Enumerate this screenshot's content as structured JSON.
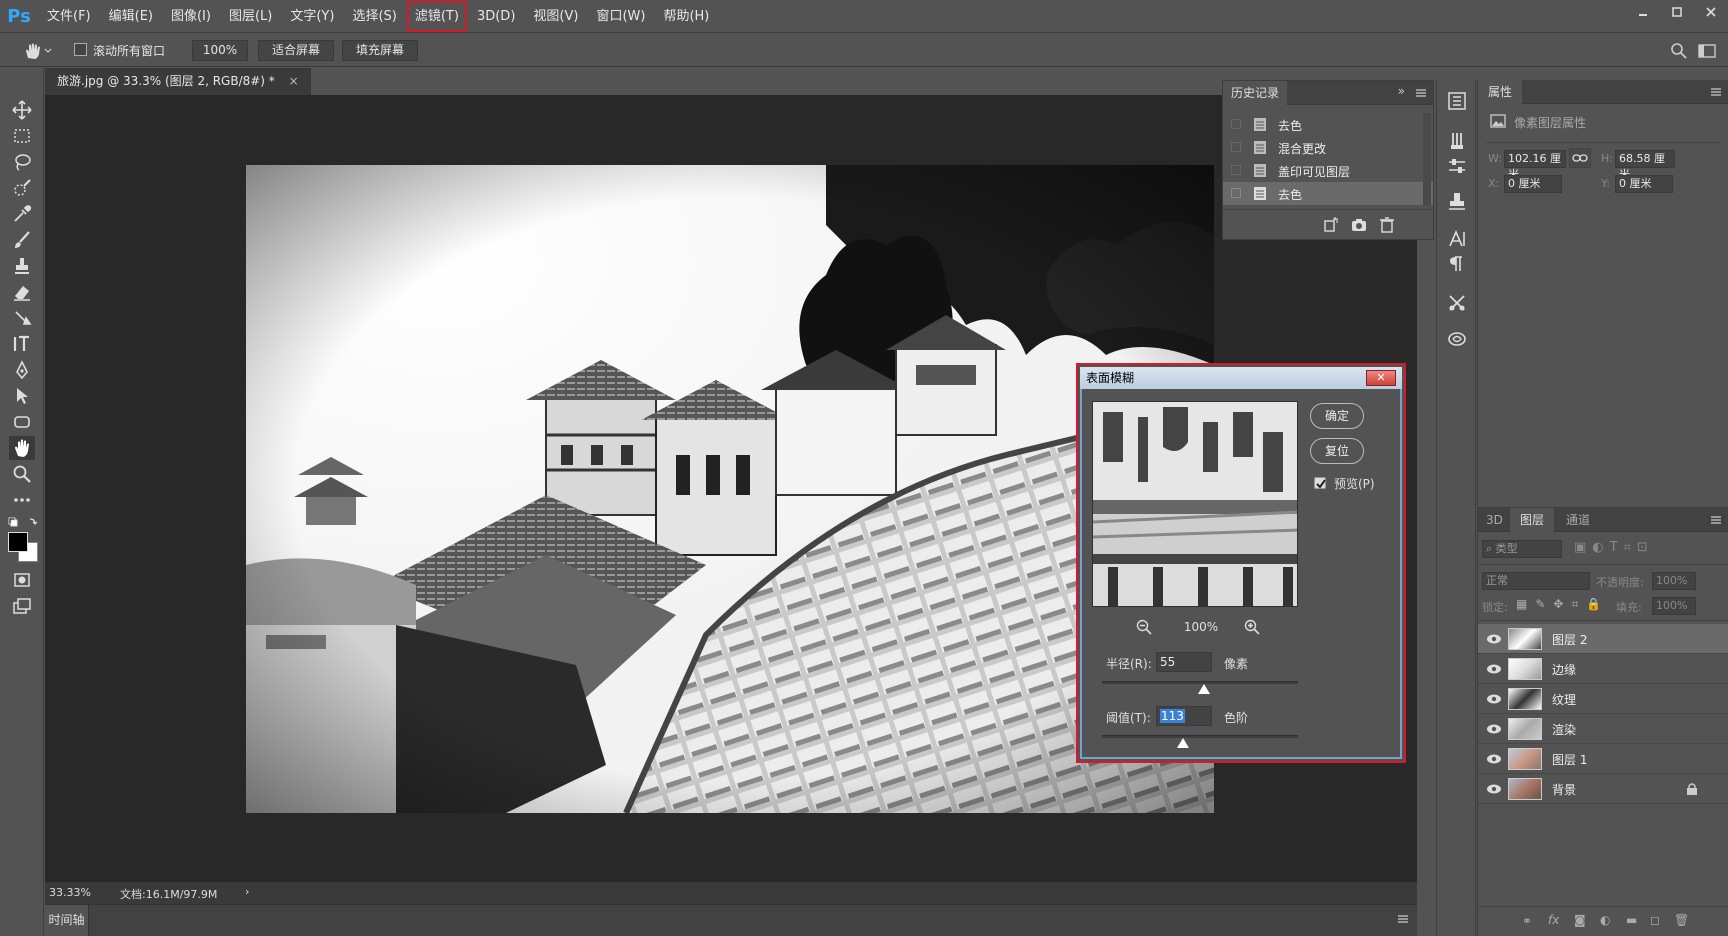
{
  "app": {
    "logo": "Ps"
  },
  "menu": [
    "文件(F)",
    "编辑(E)",
    "图像(I)",
    "图层(L)",
    "文字(Y)",
    "选择(S)",
    "滤镜(T)",
    "3D(D)",
    "视图(V)",
    "窗口(W)",
    "帮助(H)"
  ],
  "options": {
    "scroll_all_label": "滚动所有窗口",
    "zoom_value": "100%",
    "fit_screen": "适合屏幕",
    "fill_screen": "填充屏幕"
  },
  "document": {
    "tab_title": "旅游.jpg @ 33.3% (图层 2, RGB/8#) *",
    "close_glyph": "×",
    "status_zoom": "33.33%",
    "status_doc": "文档:16.1M/97.9M",
    "status_arrow": "›",
    "timeline_label": "时间轴"
  },
  "history": {
    "title": "历史记录",
    "items": [
      "去色",
      "混合更改",
      "盖印可见图层",
      "去色"
    ],
    "selected_index": 3
  },
  "properties": {
    "title": "属性",
    "subtitle": "像素图层属性",
    "w_label": "W:",
    "w_value": "102.16 厘米",
    "h_label": "H:",
    "h_value": "68.58 厘米",
    "x_label": "X:",
    "x_value": "0 厘米",
    "y_label": "Y:",
    "y_value": "0 厘米"
  },
  "layers_panel": {
    "tabs": [
      "3D",
      "图层",
      "通道"
    ],
    "active_tab": 1,
    "filter_placeholder": "类型",
    "blend_mode": "正常",
    "opacity_label": "不透明度:",
    "opacity_value": "100%",
    "lock_label": "锁定:",
    "fill_label": "填充:",
    "fill_value": "100%",
    "layers": [
      {
        "name": "图层 2",
        "selected": true,
        "locked": false
      },
      {
        "name": "边缘",
        "selected": false,
        "locked": false
      },
      {
        "name": "纹理",
        "selected": false,
        "locked": false
      },
      {
        "name": "渲染",
        "selected": false,
        "locked": false
      },
      {
        "name": "图层 1",
        "selected": false,
        "locked": false
      },
      {
        "name": "背景",
        "selected": false,
        "locked": true
      }
    ]
  },
  "dialog": {
    "title": "表面模糊",
    "close_glyph": "✕",
    "ok": "确定",
    "reset": "复位",
    "preview_label": "预览(P)",
    "preview_checked": true,
    "zoom_value": "100%",
    "radius_label": "半径(R):",
    "radius_value": "55",
    "radius_unit": "像素",
    "threshold_label": "阈值(T):",
    "threshold_value": "113",
    "threshold_unit": "色阶"
  },
  "colors": {
    "highlight_red": "#d8192a",
    "ps_blue": "#31a8ff",
    "selection_blue": "#3a82d8"
  }
}
